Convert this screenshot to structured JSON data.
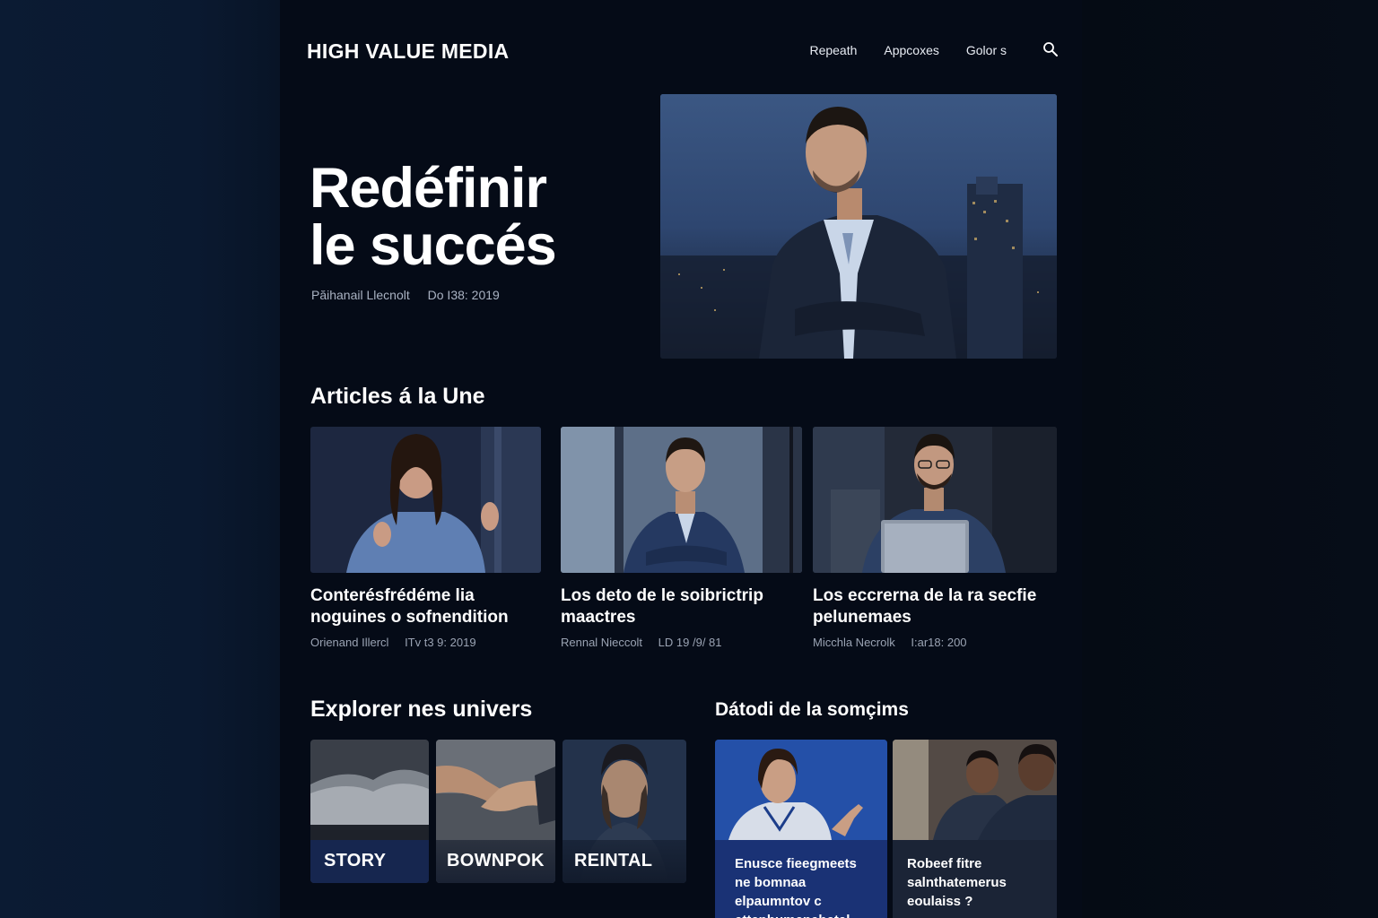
{
  "brand": {
    "name": "HIGH VALUE MEDIA"
  },
  "nav": {
    "items": [
      "Repeath",
      "Appcoxes",
      "Golor s"
    ]
  },
  "hero": {
    "title_line1": "Redéfinir",
    "title_line2": "le succés",
    "author": "Păihanail Llecnolt",
    "date": "Do I38: 2019"
  },
  "sections": {
    "featured": "Articles á la Une",
    "explore": "Explorer nes univers",
    "dato": "Dátodi de la somçims"
  },
  "articles": [
    {
      "title": "Conterésfrédéme lia noguines o sofnendition",
      "author": "Orienand Illercl",
      "date": "ITv t3 9: 2019"
    },
    {
      "title": "Los deto de le soibrictrip maactres",
      "author": "Rennal Nieccolt",
      "date": "LD 19 /9/ 81"
    },
    {
      "title": "Los eccrerna de la ra secfie pelunemaes",
      "author": "Micchla Necrolk",
      "date": "I:ar18: 200"
    }
  ],
  "universes": [
    "STORY",
    "BOWNPOK",
    "REINTAL"
  ],
  "dato_cards": [
    {
      "text": "Enusce fieegmeets ne bomnaa elpaumntov c ettenhumcnehetal"
    },
    {
      "text": "Robeef fitre salnthatemerus eoulaiss ?"
    }
  ],
  "colors": {
    "page_bg": "#050b17",
    "accent_blue": "#1a3275",
    "text_primary": "#ffffff",
    "text_muted": "#9aa3b3"
  }
}
